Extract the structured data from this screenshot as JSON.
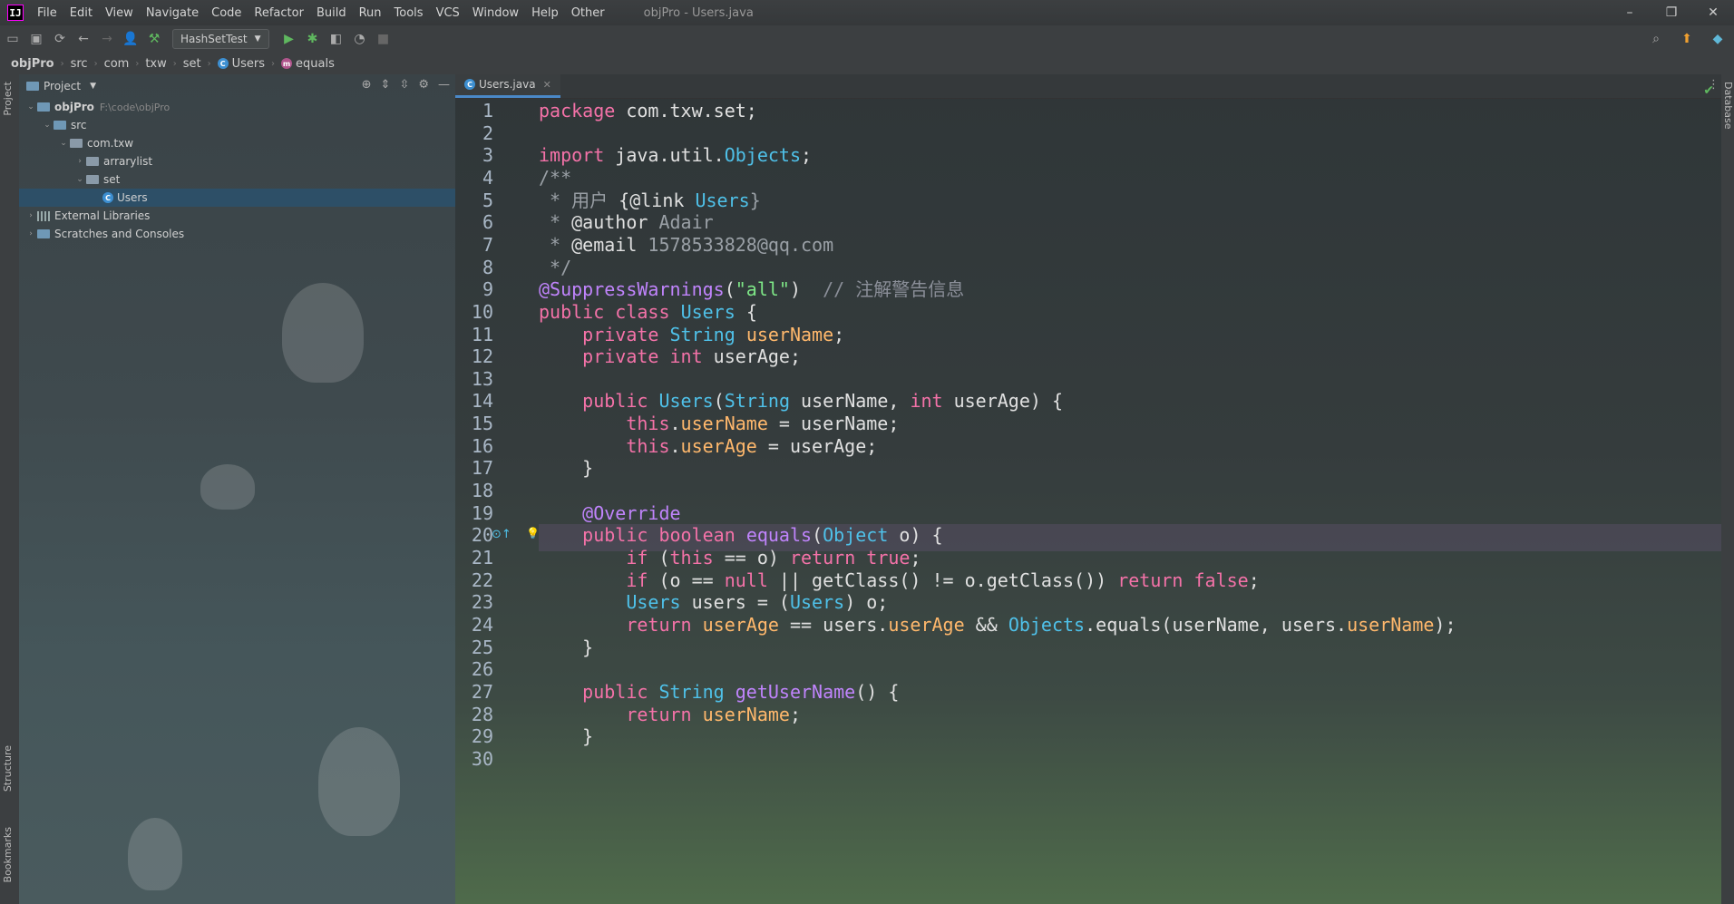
{
  "menubar": {
    "logo": "IJ",
    "items": [
      "File",
      "Edit",
      "View",
      "Navigate",
      "Code",
      "Refactor",
      "Build",
      "Run",
      "Tools",
      "VCS",
      "Window",
      "Help",
      "Other"
    ],
    "window_title": "objPro - Users.java",
    "controls": {
      "minimize": "–",
      "restore": "❐",
      "close": "✕"
    }
  },
  "toolbar": {
    "run_config": "HashSetTest"
  },
  "breadcrumb": [
    "objPro",
    "src",
    "com",
    "txw",
    "set",
    "Users",
    "equals"
  ],
  "side_tabs": {
    "project": "Project",
    "structure": "Structure",
    "bookmarks": "Bookmarks",
    "database": "Database"
  },
  "project": {
    "title": "Project",
    "tree": [
      {
        "label": "objPro",
        "hint": "F:\\code\\objPro",
        "depth": 0,
        "arrow": "⌄",
        "kind": "folder-blue",
        "bold": true
      },
      {
        "label": "src",
        "depth": 1,
        "arrow": "⌄",
        "kind": "folder-blue"
      },
      {
        "label": "com.txw",
        "depth": 2,
        "arrow": "⌄",
        "kind": "folder"
      },
      {
        "label": "arrarylist",
        "depth": 3,
        "arrow": "›",
        "kind": "folder"
      },
      {
        "label": "set",
        "depth": 3,
        "arrow": "⌄",
        "kind": "folder"
      },
      {
        "label": "Users",
        "depth": 4,
        "arrow": "",
        "kind": "class",
        "selected": true
      },
      {
        "label": "External Libraries",
        "depth": 0,
        "arrow": "›",
        "kind": "lib"
      },
      {
        "label": "Scratches and Consoles",
        "depth": 0,
        "arrow": "›",
        "kind": "scratch"
      }
    ]
  },
  "editor": {
    "tab": "Users.java",
    "line_numbers": [
      "1",
      "2",
      "3",
      "4",
      "5",
      "6",
      "7",
      "8",
      "9",
      "10",
      "11",
      "12",
      "13",
      "14",
      "15",
      "16",
      "17",
      "18",
      "19",
      "20",
      "21",
      "22",
      "23",
      "24",
      "25",
      "26",
      "27",
      "28",
      "29",
      "30"
    ],
    "code_lines": [
      "package com.txw.set;",
      "",
      "import java.util.Objects;",
      "/**",
      " * 用户 {@link Users}",
      " * @author Adair",
      " * @email 1578533828@qq.com",
      " */",
      "@SuppressWarnings(\"all\")  // 注解警告信息",
      "public class Users {",
      "    private String userName;",
      "    private int userAge;",
      "",
      "    public Users(String userName, int userAge) {",
      "        this.userName = userName;",
      "        this.userAge = userAge;",
      "    }",
      "",
      "    @Override",
      "    public boolean equals(Object o) {",
      "        if (this == o) return true;",
      "        if (o == null || getClass() != o.getClass()) return false;",
      "        Users users = (Users) o;",
      "        return userAge == users.userAge && Objects.equals(userName, users.userName);",
      "    }",
      "",
      "    public String getUserName() {",
      "        return userName;",
      "    }",
      ""
    ]
  }
}
